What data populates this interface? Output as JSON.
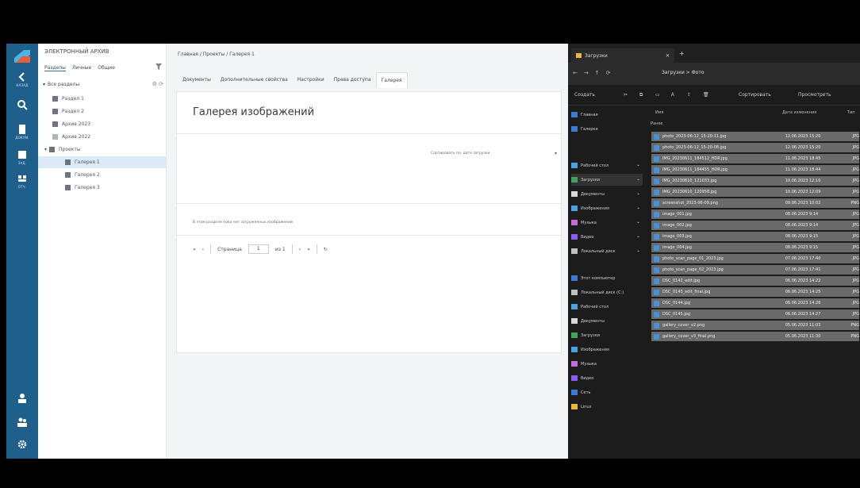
{
  "rail": {
    "items": [
      {
        "name": "back-icon",
        "label": "НАЗАД"
      },
      {
        "name": "search-icon",
        "label": ""
      },
      {
        "name": "documents-icon",
        "label": "ДОКУМ."
      },
      {
        "name": "tasks-icon",
        "label": "ЗАД."
      },
      {
        "name": "reports-icon",
        "label": "ОТЧ."
      },
      {
        "name": "user-icon",
        "label": ""
      },
      {
        "name": "users-icon",
        "label": ""
      },
      {
        "name": "settings-icon",
        "label": ""
      }
    ]
  },
  "tree": {
    "title": "ЭЛЕКТРОННЫЙ АРХИВ",
    "tabs": [
      "Разделы",
      "Личные",
      "Общие"
    ],
    "root": "Все разделы",
    "items": [
      {
        "label": "Раздел 1",
        "indent": 1
      },
      {
        "label": "Раздел 2",
        "indent": 1
      },
      {
        "label": "Архив 2023",
        "indent": 1
      },
      {
        "label": "Архив 2022",
        "indent": 1
      },
      {
        "label": "Проекты",
        "indent": 0,
        "expanded": true
      },
      {
        "label": "Галерея 1",
        "indent": 2,
        "selected": true
      },
      {
        "label": "Галерея 2",
        "indent": 2
      },
      {
        "label": "Галерея 3",
        "indent": 2
      }
    ]
  },
  "main": {
    "breadcrumb": "Главная / Проекты / Галерея 1",
    "tabs": [
      "Документы",
      "Дополнительные свойства",
      "Настройки",
      "Права доступа",
      "Галерея"
    ],
    "active_tab": 4,
    "title": "Галерея изображений",
    "sort_label": "Сортировать по: дате загрузки",
    "empty_message": "В этом разделе пока нет загруженных изображений",
    "pager": {
      "first": "«",
      "prev": "‹",
      "page_label": "Страница",
      "page_value": "1",
      "of_label": "из 1",
      "next": "›",
      "last": "»",
      "refresh": "↻"
    }
  },
  "explorer": {
    "tab_title": "Загрузки",
    "path": "Загрузки  >  Фото",
    "commands": [
      "Создать",
      "Сортировать",
      "Просмотреть"
    ],
    "nav_items": [
      {
        "label": "Главная",
        "color": "#3a7bd5"
      },
      {
        "label": "Галерея",
        "color": "#3a7bd5"
      },
      {
        "label": "Рабочий стол",
        "color": "#4aa3df"
      },
      {
        "label": "Загрузки",
        "color": "#3fa35b",
        "selected": true
      },
      {
        "label": "Документы",
        "color": "#d8d8d8"
      },
      {
        "label": "Изображения",
        "color": "#4aa3df"
      },
      {
        "label": "Музыка",
        "color": "#c56bdc"
      },
      {
        "label": "Видео",
        "color": "#8b5cf6"
      },
      {
        "label": "Локальный диск",
        "color": "#c0c0c0"
      },
      {
        "label": "Этот компьютер",
        "color": "#3a7bd5"
      },
      {
        "label": "Локальный диск (C:)",
        "color": "#c0c0c0"
      },
      {
        "label": "Рабочий стол",
        "color": "#4aa3df"
      },
      {
        "label": "Документы",
        "color": "#d8d8d8"
      },
      {
        "label": "Загрузки",
        "color": "#3fa35b"
      },
      {
        "label": "Изображения",
        "color": "#4aa3df"
      },
      {
        "label": "Музыка",
        "color": "#c56bdc"
      },
      {
        "label": "Видео",
        "color": "#8b5cf6"
      },
      {
        "label": "Сеть",
        "color": "#3a7bd5"
      },
      {
        "label": "Linux",
        "color": "#e8b83a"
      }
    ],
    "columns": [
      "Имя",
      "Дата изменения",
      "Тип"
    ],
    "group": "Ранее",
    "files": [
      {
        "name": "photo_2023-06-12_15-20-11.jpg",
        "date": "12.06.2023 15:20",
        "type": "JPG"
      },
      {
        "name": "photo_2023-06-12_15-20-08.jpg",
        "date": "12.06.2023 15:20",
        "type": "JPG"
      },
      {
        "name": "IMG_20230611_184512_HDR.jpg",
        "date": "11.06.2023 18:45",
        "type": "JPG"
      },
      {
        "name": "IMG_20230611_184455_HDR.jpg",
        "date": "11.06.2023 18:44",
        "type": "JPG"
      },
      {
        "name": "IMG_20230610_121033.jpg",
        "date": "10.06.2023 12:10",
        "type": "JPG"
      },
      {
        "name": "IMG_20230610_120958.jpg",
        "date": "10.06.2023 12:09",
        "type": "JPG"
      },
      {
        "name": "screenshot_2023-06-09.png",
        "date": "09.06.2023 10:02",
        "type": "PNG"
      },
      {
        "name": "image_001.jpg",
        "date": "08.06.2023 9:14",
        "type": "JPG"
      },
      {
        "name": "image_002.jpg",
        "date": "08.06.2023 9:14",
        "type": "JPG"
      },
      {
        "name": "image_003.jpg",
        "date": "08.06.2023 9:15",
        "type": "JPG"
      },
      {
        "name": "image_004.jpg",
        "date": "08.06.2023 9:15",
        "type": "JPG"
      },
      {
        "name": "photo_scan_page_01_2023.jpg",
        "date": "07.06.2023 17:40",
        "type": "JPG"
      },
      {
        "name": "photo_scan_page_02_2023.jpg",
        "date": "07.06.2023 17:41",
        "type": "JPG"
      },
      {
        "name": "DSC_0142_edit.jpg",
        "date": "06.06.2023 14:22",
        "type": "JPG"
      },
      {
        "name": "DSC_0143_edit_final.jpg",
        "date": "06.06.2023 14:25",
        "type": "JPG"
      },
      {
        "name": "DSC_0144.jpg",
        "date": "06.06.2023 14:26",
        "type": "JPG"
      },
      {
        "name": "DSC_0145.jpg",
        "date": "06.06.2023 14:27",
        "type": "JPG"
      },
      {
        "name": "gallery_cover_v2.png",
        "date": "05.06.2023 11:03",
        "type": "PNG"
      },
      {
        "name": "gallery_cover_v3_final.png",
        "date": "05.06.2023 11:30",
        "type": "PNG"
      }
    ]
  }
}
